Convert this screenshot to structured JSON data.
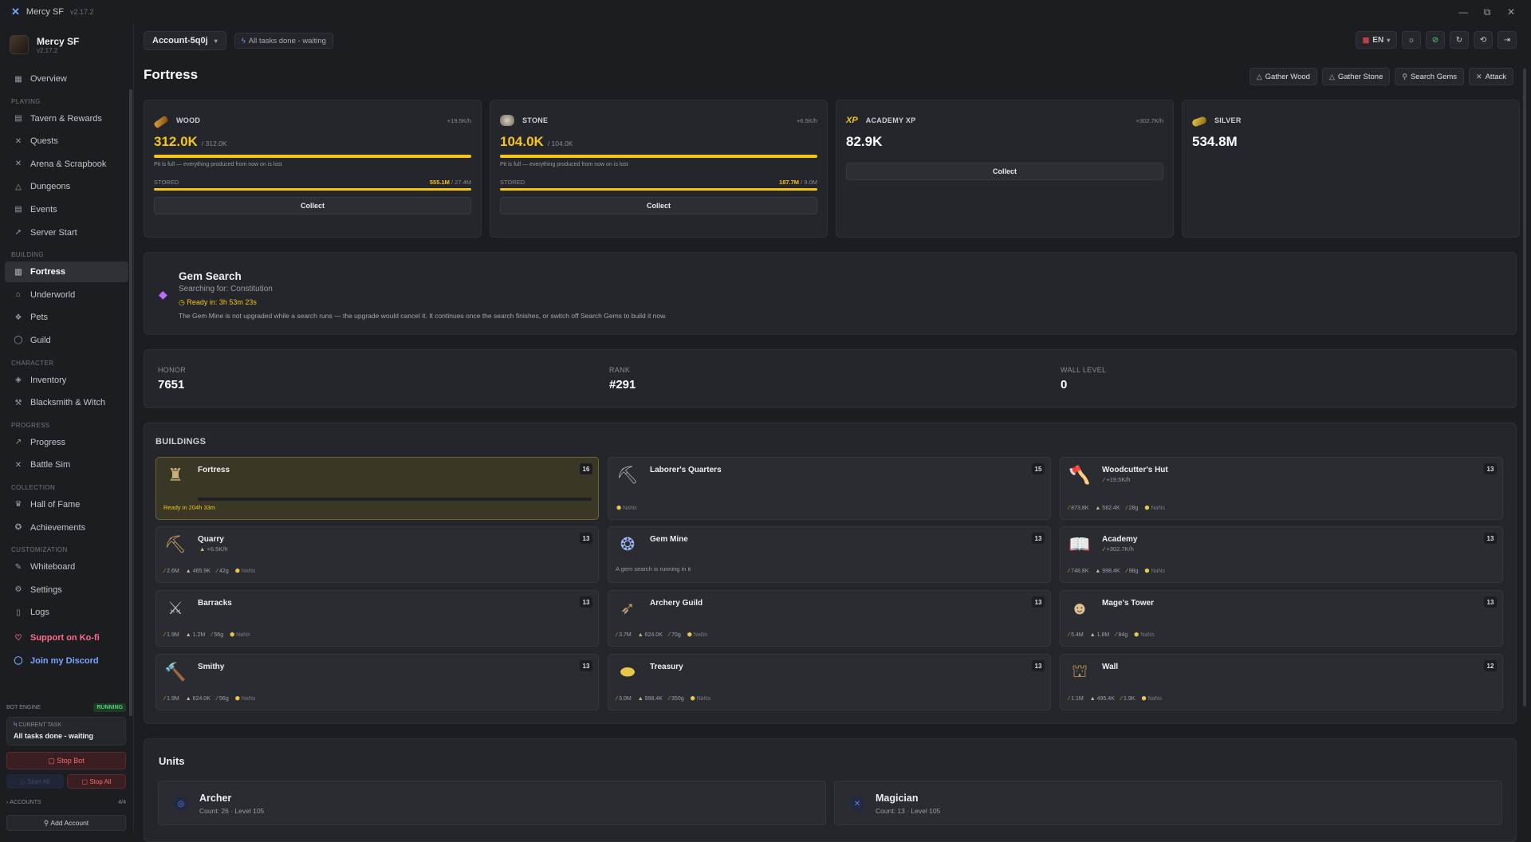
{
  "app": {
    "title": "Mercy SF",
    "version": "v2.17.2"
  },
  "window_controls": {
    "minimize": "—",
    "restore": "⧉",
    "close": "✕"
  },
  "sidebar": {
    "brand_title": "Mercy SF",
    "brand_sub": "v2.17.2",
    "sections": {
      "playing": "PLAYING",
      "building": "BUILDING",
      "character": "CHARACTER",
      "progress": "PROGRESS",
      "collection": "COLLECTION",
      "customization": "CUSTOMIZATION"
    },
    "items": {
      "overview": "Overview",
      "tavern": "Tavern & Rewards",
      "quests": "Quests",
      "arena": "Arena & Scrapbook",
      "dungeons": "Dungeons",
      "events": "Events",
      "server_start": "Server Start",
      "fortress": "Fortress",
      "underworld": "Underworld",
      "pets": "Pets",
      "guild": "Guild",
      "inventory": "Inventory",
      "blacksmith": "Blacksmith & Witch",
      "progress": "Progress",
      "battle_sim": "Battle Sim",
      "hall_of_fame": "Hall of Fame",
      "achievements": "Achievements",
      "whiteboard": "Whiteboard",
      "settings": "Settings",
      "logs": "Logs",
      "kofi": "Support on Ko-fi",
      "discord": "Join my Discord"
    },
    "engine": {
      "label": "BOT ENGINE",
      "status": "RUNNING",
      "current_task_label": "CURRENT TASK",
      "current_task": "All tasks done - waiting",
      "stop_bot": "Stop Bot",
      "start_all": "Start All",
      "stop_all": "Stop All",
      "accounts_label": "ACCOUNTS",
      "accounts_count": "4/4",
      "add_account": "Add Account"
    }
  },
  "topbar": {
    "account": "Account-5q0j",
    "status": "All tasks done - waiting",
    "lang": "EN"
  },
  "page": {
    "title": "Fortress",
    "actions": {
      "gather_wood": "Gather Wood",
      "gather_stone": "Gather Stone",
      "search_gems": "Search Gems",
      "attack": "Attack"
    }
  },
  "resources": {
    "wood": {
      "name": "WOOD",
      "rate": "+19.5K/h",
      "amount": "312.0K",
      "cap": "/ 312.0K",
      "fill": 1.0,
      "note": "Pit is full — everything produced from now on is lost",
      "stored_label": "STORED",
      "stored": "555.1M",
      "stored_cap": "/ 27.4M",
      "stored_fill": 1.0,
      "button": "Collect"
    },
    "stone": {
      "name": "STONE",
      "rate": "+6.5K/h",
      "amount": "104.0K",
      "cap": "/ 104.0K",
      "fill": 1.0,
      "note": "Pit is full — everything produced from now on is lost",
      "stored_label": "STORED",
      "stored": "187.7M",
      "stored_cap": "/ 9.0M",
      "stored_fill": 1.0,
      "button": "Collect"
    },
    "academy": {
      "icon_text": "XP",
      "name": "ACADEMY XP",
      "rate": "+302.7K/h",
      "amount": "82.9K",
      "button": "Collect"
    },
    "silver": {
      "name": "SILVER",
      "amount": "534.8M"
    }
  },
  "gem_search": {
    "title": "Gem Search",
    "searching": "Searching for: Constitution",
    "ready": "Ready in: 3h 53m 23s",
    "desc": "The Gem Mine is not upgraded while a search runs — the upgrade would cancel it. It continues once the search finishes, or switch off Search Gems to build it now."
  },
  "stats": {
    "honor_label": "HONOR",
    "honor": "7651",
    "rank_label": "RANK",
    "rank": "#291",
    "wall_label": "WALL LEVEL",
    "wall": "0"
  },
  "buildings": {
    "title": "BUILDINGS",
    "nan": "NaNs",
    "fortress": {
      "name": "Fortress",
      "level": "16",
      "ready": "Ready in 204h 33m"
    },
    "laborers": {
      "name": "Laborer's Quarters",
      "level": "15"
    },
    "woodcutter": {
      "name": "Woodcutter's Hut",
      "level": "13",
      "rate": "+19.5K/h",
      "wood": "873.8K",
      "stone": "582.4K",
      "gem": "28g"
    },
    "quarry": {
      "name": "Quarry",
      "level": "13",
      "rate": "+6.5K/h",
      "wood": "2.6M",
      "stone": "465.9K",
      "gem": "42g"
    },
    "gem_mine": {
      "name": "Gem Mine",
      "level": "13",
      "info": "A gem search is running in it"
    },
    "academy": {
      "name": "Academy",
      "level": "13",
      "rate": "+302.7K/h",
      "wood": "748.8K",
      "stone": "998.4K",
      "gem": "98g"
    },
    "barracks": {
      "name": "Barracks",
      "level": "13",
      "wood": "1.9M",
      "stone": "1.2M",
      "gem": "56g"
    },
    "archery": {
      "name": "Archery Guild",
      "level": "13",
      "wood": "3.7M",
      "stone": "624.0K",
      "gem": "70g"
    },
    "mage_tower": {
      "name": "Mage's Tower",
      "level": "13",
      "wood": "5.4M",
      "stone": "1.8M",
      "gem": "84g"
    },
    "smithy": {
      "name": "Smithy",
      "level": "13",
      "wood": "1.9M",
      "stone": "624.0K",
      "gem": "56g"
    },
    "treasury": {
      "name": "Treasury",
      "level": "13",
      "wood": "3.0M",
      "stone": "998.4K",
      "gem": "350g"
    },
    "wall": {
      "name": "Wall",
      "level": "12",
      "wood": "1.1M",
      "stone": "495.4K",
      "gem": "1.9K"
    }
  },
  "units": {
    "title": "Units",
    "archer": {
      "name": "Archer",
      "sub": "Count: 26 · Level 105"
    },
    "magician": {
      "name": "Magician",
      "sub": "Count: 13 · Level 105"
    }
  }
}
